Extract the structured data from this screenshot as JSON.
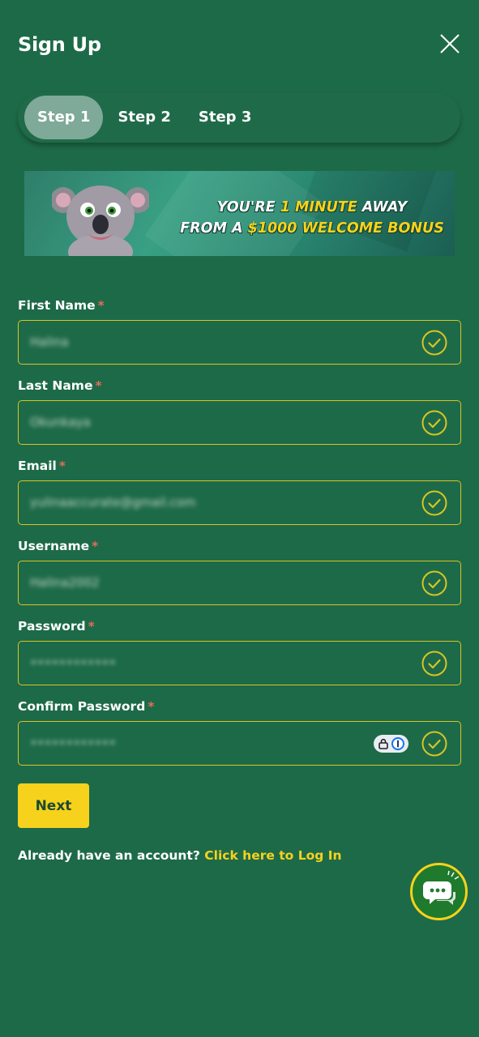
{
  "header": {
    "title": "Sign Up",
    "close_icon": "close-icon"
  },
  "steps": [
    {
      "label": "Step 1",
      "active": true
    },
    {
      "label": "Step 2",
      "active": false
    },
    {
      "label": "Step 3",
      "active": false
    }
  ],
  "banner": {
    "line1_a": "YOU'RE ",
    "line1_b": "1 MINUTE",
    "line1_c": " AWAY",
    "line2_a": "FROM A ",
    "line2_b": "$1000 WELCOME BONUS"
  },
  "form": {
    "required_mark": "*",
    "fields": [
      {
        "label": "First Name",
        "value": "Halina",
        "valid": true
      },
      {
        "label": "Last Name",
        "value": "Okunkaya",
        "valid": true
      },
      {
        "label": "Email",
        "value": "yulinaaccurate@gmail.com",
        "valid": true
      },
      {
        "label": "Username",
        "value": "Halina2002",
        "valid": true
      },
      {
        "label": "Password",
        "value": "••••••••••••",
        "valid": true
      },
      {
        "label": "Confirm Password",
        "value": "••••••••••••",
        "valid": true
      }
    ]
  },
  "next_button": {
    "label": "Next"
  },
  "login": {
    "prompt": "Already have an account? ",
    "link": "Click here to Log In"
  },
  "colors": {
    "background": "#1d6a48",
    "accent": "#f6d21c",
    "required": "#e86a5a"
  }
}
